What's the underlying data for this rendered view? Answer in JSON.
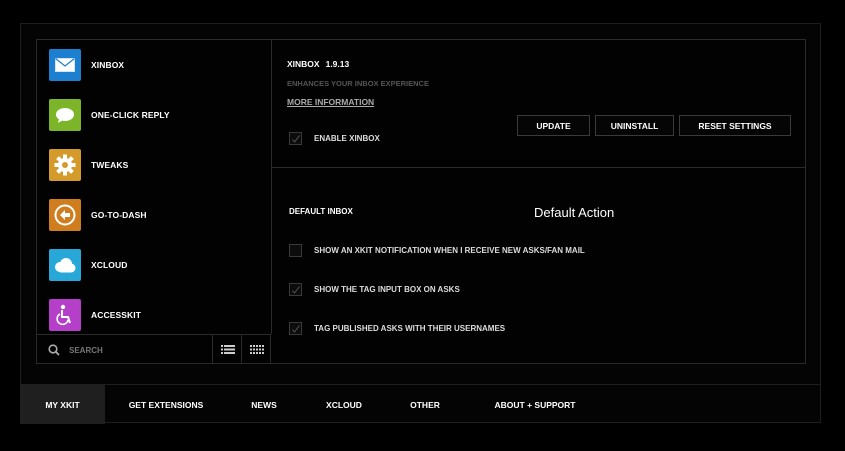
{
  "extensions": [
    {
      "label": "XINBOX",
      "icon": "envelope-icon",
      "color": "#1d7fd0"
    },
    {
      "label": "ONE-CLICK REPLY",
      "icon": "speech-bubble-icon",
      "color": "#7cb52a"
    },
    {
      "label": "TWEAKS",
      "icon": "gear-icon",
      "color": "#d49a2a"
    },
    {
      "label": "GO-TO-DASH",
      "icon": "back-arrow-icon",
      "color": "#cf7d1f"
    },
    {
      "label": "XCLOUD",
      "icon": "cloud-icon",
      "color": "#28a8d8"
    },
    {
      "label": "ACCESSKIT",
      "icon": "wheelchair-icon",
      "color": "#b53fc9"
    }
  ],
  "search": {
    "placeholder": "SEARCH"
  },
  "detail": {
    "title": "XINBOX",
    "version": "1.9.13",
    "description": "ENHANCES YOUR INBOX EXPERIENCE",
    "more_info": "MORE INFORMATION",
    "enable_label": "ENABLE XINBOX",
    "enabled": true,
    "buttons": {
      "update": "UPDATE",
      "uninstall": "UNINSTALL",
      "reset": "RESET SETTINGS"
    }
  },
  "settings": {
    "section_title": "DEFAULT INBOX",
    "default_action": "Default Action",
    "options": [
      {
        "label": "SHOW AN XKIT NOTIFICATION WHEN I RECEIVE NEW ASKS/FAN MAIL",
        "checked": false
      },
      {
        "label": "SHOW THE TAG INPUT BOX ON ASKS",
        "checked": true
      },
      {
        "label": "TAG PUBLISHED ASKS WITH THEIR USERNAMES",
        "checked": true
      }
    ]
  },
  "nav": {
    "items": [
      "MY XKIT",
      "GET EXTENSIONS",
      "NEWS",
      "XCLOUD",
      "OTHER",
      "ABOUT + SUPPORT"
    ],
    "active": "MY XKIT"
  },
  "colors": {
    "background": "#000000",
    "active_tab": "#1f1f1f",
    "border": "#2a2a2a"
  }
}
